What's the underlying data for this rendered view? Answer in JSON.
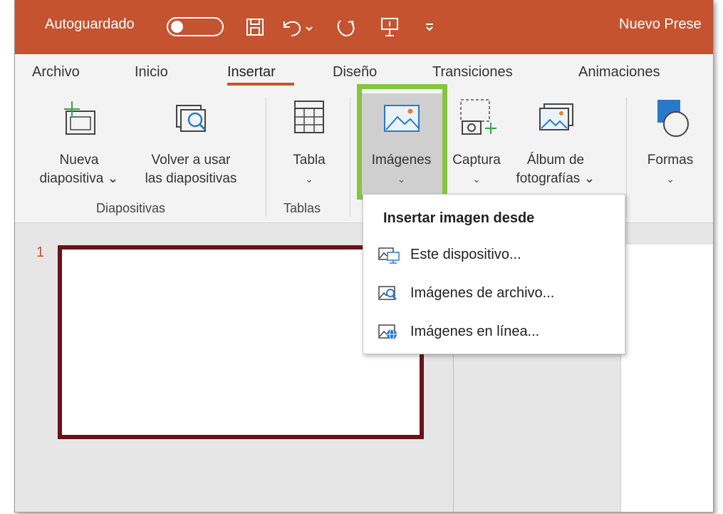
{
  "titlebar": {
    "autosave_label": "Autoguardado",
    "doc_title": "Nuevo Prese"
  },
  "tabs": [
    {
      "label": "Archivo"
    },
    {
      "label": "Inicio"
    },
    {
      "label": "Insertar"
    },
    {
      "label": "Diseño"
    },
    {
      "label": "Transiciones"
    },
    {
      "label": "Animaciones"
    }
  ],
  "ribbon": {
    "nueva_line1": "Nueva",
    "nueva_line2": "diapositiva ⌄",
    "volver_line1": "Volver a usar",
    "volver_line2": "las diapositivas",
    "tabla": "Tabla",
    "imagenes": "Imágenes",
    "captura": "Captura",
    "album_line1": "Álbum de",
    "album_line2": "fotografías ⌄",
    "formas": "Formas",
    "chevron": "⌄",
    "group_diapositivas": "Diapositivas",
    "group_tablas": "Tablas"
  },
  "workspace": {
    "slide_number": "1"
  },
  "menu": {
    "heading": "Insertar imagen desde",
    "items": [
      {
        "label": "Este dispositivo...",
        "icon": "device-image-icon"
      },
      {
        "label": "Imágenes de archivo...",
        "icon": "stock-image-icon"
      },
      {
        "label": "Imágenes en línea...",
        "icon": "online-image-icon"
      }
    ]
  },
  "colors": {
    "accent": "#c55330",
    "highlight": "#86c540",
    "thumbnail_border": "#6b1118"
  }
}
